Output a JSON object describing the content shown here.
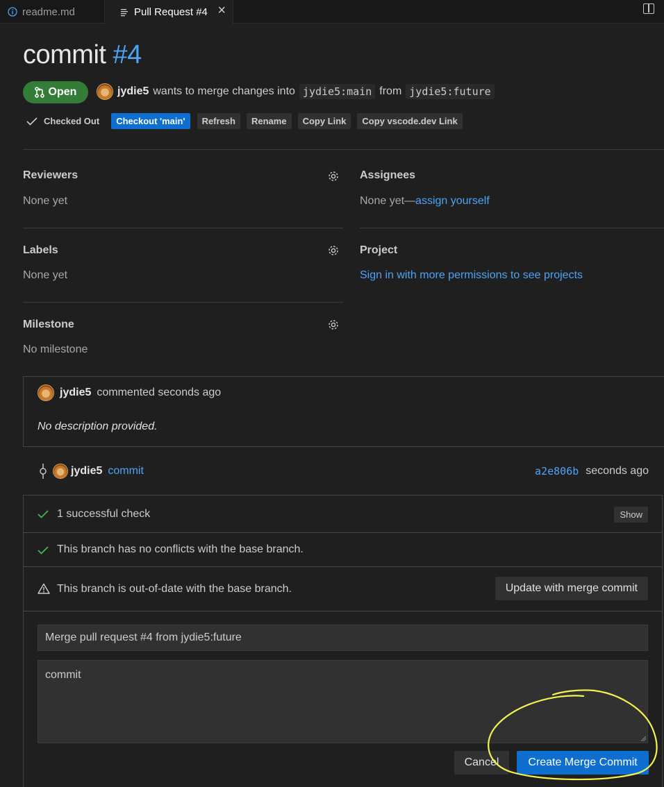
{
  "tabs": [
    {
      "label": "readme.md",
      "icon": "info-icon"
    },
    {
      "label": "Pull Request #4",
      "icon": "pull-request-file-icon"
    }
  ],
  "pr": {
    "title": "commit",
    "number": "#4",
    "state": "Open",
    "author": "jydie5",
    "merge_text": "wants to merge changes into",
    "base": "jydie5:main",
    "from_word": "from",
    "head": "jydie5:future"
  },
  "actions": {
    "checked_out": "Checked Out",
    "checkout_main": "Checkout 'main'",
    "refresh": "Refresh",
    "rename": "Rename",
    "copy_link": "Copy Link",
    "copy_vscode": "Copy vscode.dev Link"
  },
  "sidebar": {
    "reviewers": {
      "title": "Reviewers",
      "value": "None yet"
    },
    "assignees": {
      "title": "Assignees",
      "value": "None yet—",
      "link": "assign yourself"
    },
    "labels": {
      "title": "Labels",
      "value": "None yet"
    },
    "project": {
      "title": "Project",
      "link": "Sign in with more permissions to see projects"
    },
    "milestone": {
      "title": "Milestone",
      "value": "No milestone"
    }
  },
  "comment": {
    "author": "jydie5",
    "meta": "commented seconds ago",
    "body": "No description provided."
  },
  "commit": {
    "author": "jydie5",
    "message": "commit",
    "sha": "a2e806b",
    "time": "seconds ago"
  },
  "merge": {
    "checks": "1 successful check",
    "show": "Show",
    "no_conflicts": "This branch has no conflicts with the base branch.",
    "out_of_date": "This branch is out-of-date with the base branch.",
    "update_button": "Update with merge commit",
    "title_value": "Merge pull request #4 from jydie5:future",
    "description_value": "commit",
    "cancel": "Cancel",
    "create": "Create Merge Commit"
  },
  "colors": {
    "background": "#1f1f1f",
    "accent": "#0e6fd0",
    "link": "#4da3f5",
    "open_badge": "#347d39",
    "success": "#3fb950",
    "annotation": "#f2f250"
  }
}
